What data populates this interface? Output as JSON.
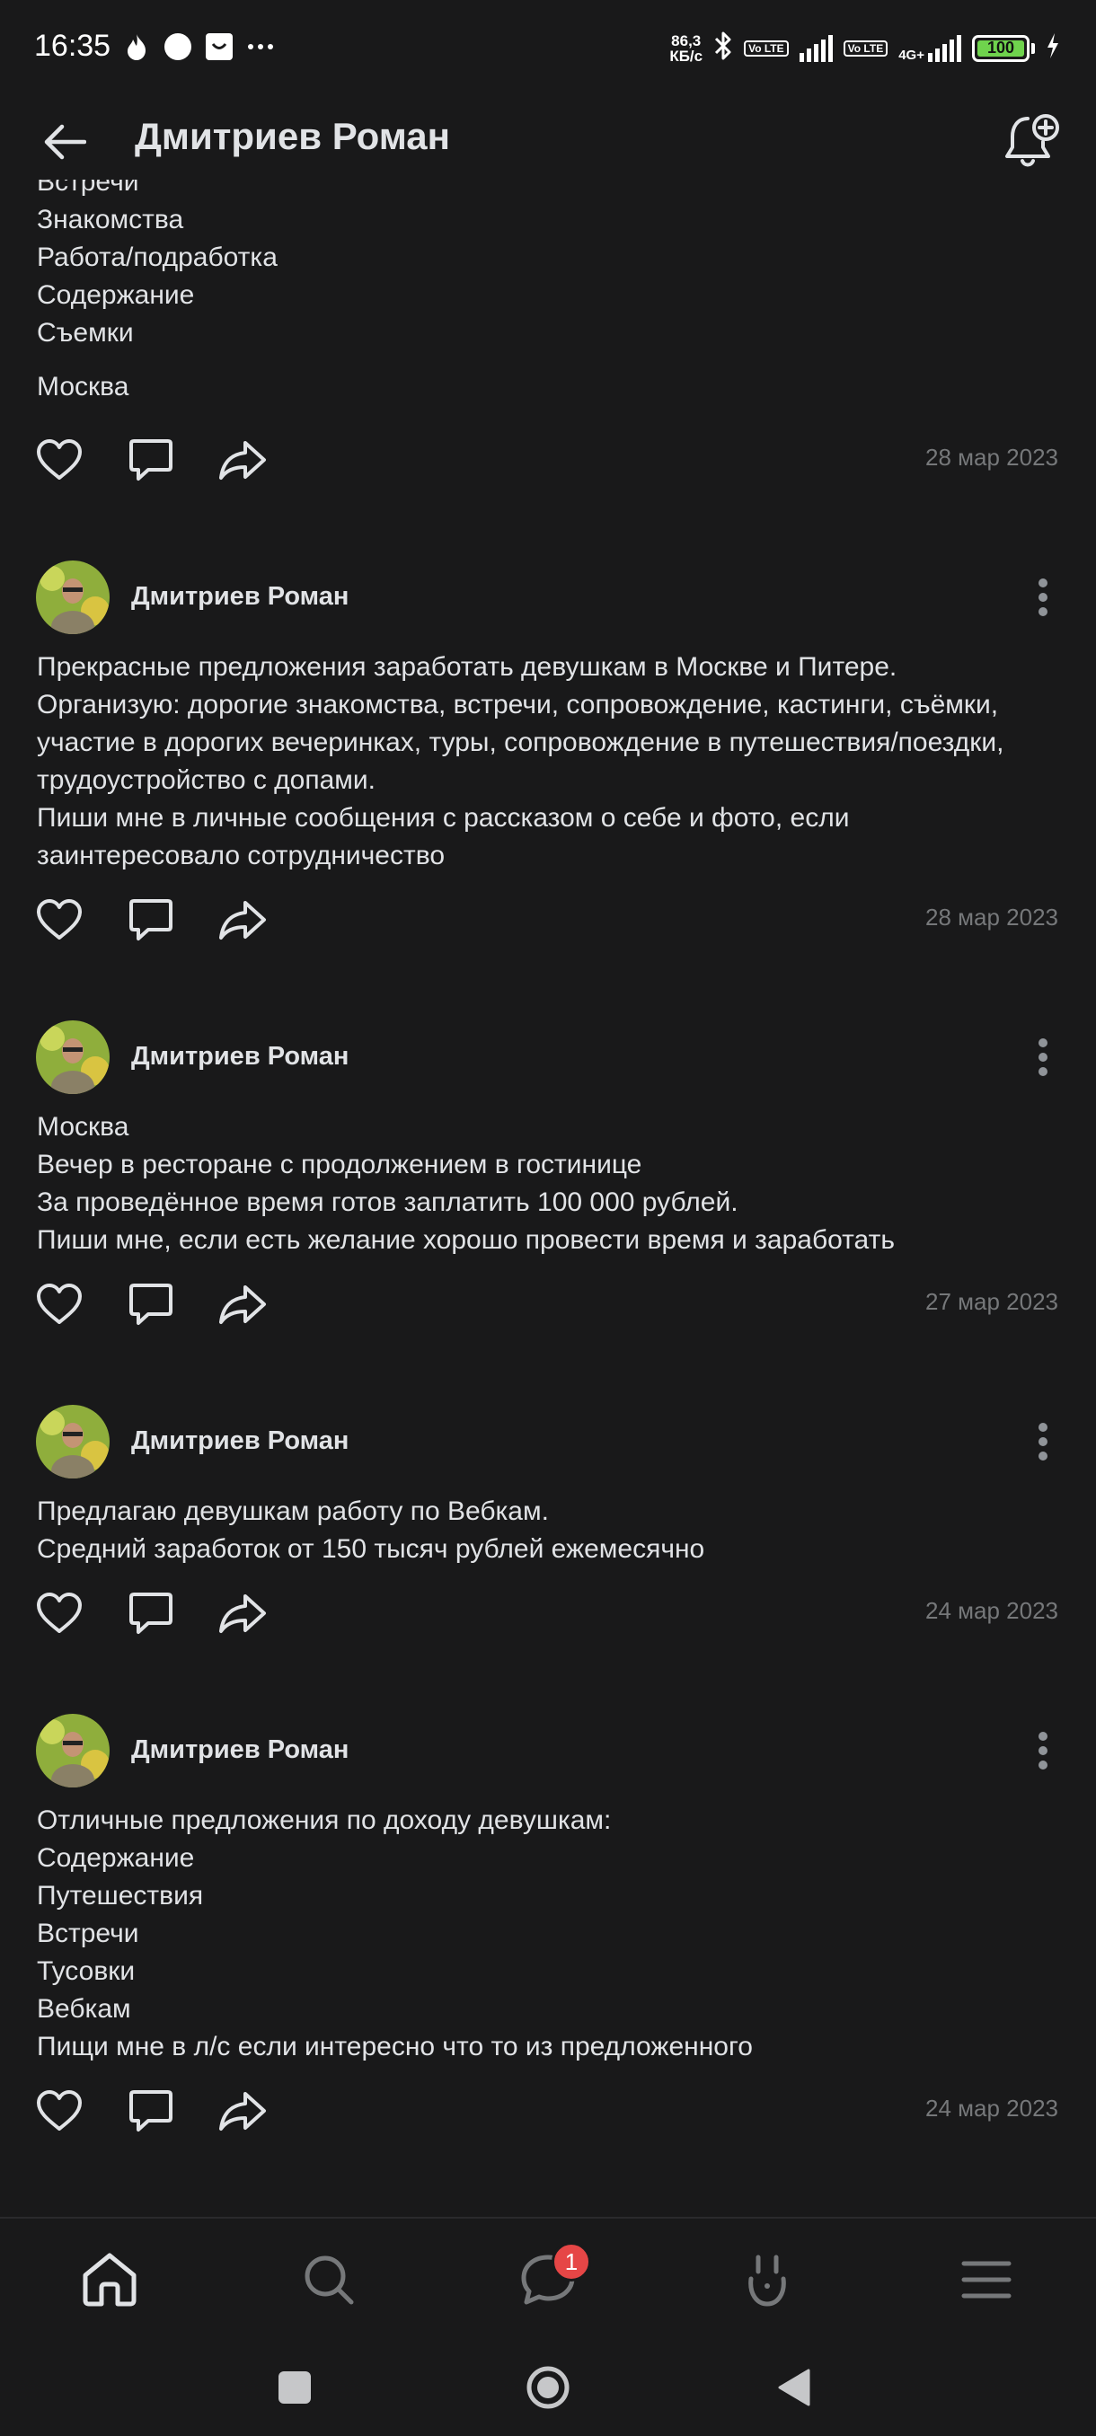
{
  "status_bar": {
    "time": "16:35",
    "left_icons": [
      "flame-icon",
      "circle-icon",
      "smile-box-icon",
      "more-dots-icon"
    ],
    "net_speed_value": "86,3",
    "net_speed_unit": "КБ/с",
    "sim1_label": "Vo LTE",
    "sim2_label": "Vo LTE",
    "network_type": "4G+",
    "battery": "100"
  },
  "header": {
    "title": "Дмитриев Роман"
  },
  "partial_post": {
    "lines": "Встречи\nЗнакомства\nРабота/подработка\nСодержание\nСъемки",
    "city": "Москва",
    "date": "28 мар 2023"
  },
  "posts": [
    {
      "author": "Дмитриев Роман",
      "text": "Прекрасные предложения заработать девушкам в Москве и Питере.\nОрганизую: дорогие знакомства, встречи, сопровождение, кастинги, съёмки, участие в дорогих вечеринках, туры, сопровождение в путешествия/поездки, трудоустройство с допами.\nПиши мне в личные сообщения с рассказом о себе и фото, если заинтересовало сотрудничество",
      "date": "28 мар 2023"
    },
    {
      "author": "Дмитриев Роман",
      "text": "Москва\nВечер в ресторане с продолжением в гостинице\nЗа проведённое время готов заплатить 100 000 рублей.\nПиши мне, если есть желание хорошо провести время и заработать",
      "date": "27 мар 2023"
    },
    {
      "author": "Дмитриев Роман",
      "text": "Предлагаю девушкам работу по Вебкам.\nСредний заработок от 150 тысяч рублей ежемесячно",
      "date": "24 мар 2023"
    },
    {
      "author": "Дмитриев Роман",
      "text": "Отличные предложения по доходу девушкам:\nСодержание\nПутешествия\nВстречи\nТусовки\nВебкам\nПищи мне в л/с если интересно что то из предложенного",
      "date": "24 мар 2023"
    }
  ],
  "bottom_nav": {
    "items": [
      "home-icon",
      "search-icon",
      "messages-icon",
      "services-icon",
      "menu-icon"
    ],
    "messages_badge": "1"
  },
  "colors": {
    "background": "#19191a",
    "text": "#e1e3e6",
    "secondary_text": "#76787a",
    "badge": "#e64646",
    "battery": "#6fd34d"
  }
}
